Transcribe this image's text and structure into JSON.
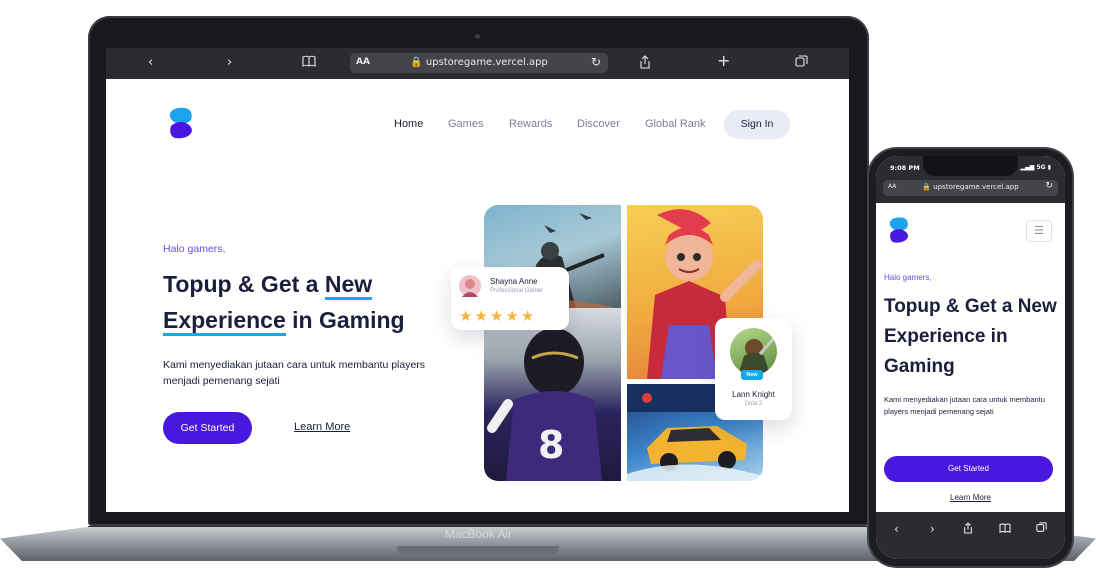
{
  "laptop": {
    "label": "MacBook Air",
    "toolbar": {
      "back_icon": "chevron-left-icon",
      "forward_icon": "chevron-right-icon",
      "reader_icon": "book-icon",
      "text_size": "AA",
      "url": "upstoregame.vercel.app",
      "share_icon": "share-icon",
      "new_tab_icon": "plus-icon",
      "tabs_icon": "tabs-icon"
    }
  },
  "site": {
    "nav": [
      {
        "label": "Home",
        "active": true
      },
      {
        "label": "Games"
      },
      {
        "label": "Rewards"
      },
      {
        "label": "Discover"
      },
      {
        "label": "Global Rank"
      }
    ],
    "signin_label": "Sign In",
    "hero": {
      "greeting": "Halo gamers,",
      "title_part1": "Topup & Get a ",
      "title_highlight1": "New",
      "title_highlight2": "Experience",
      "title_part2": " in Gaming",
      "description": "Kami menyediakan jutaan cara untuk membantu players menjadi pemenang sejati",
      "cta_label": "Get Started",
      "secondary_label": "Learn More"
    },
    "review_card": {
      "name": "Shayna Anne",
      "role": "Professional Gamer",
      "rating": 5
    },
    "player_card": {
      "badge": "New",
      "name": "Lann Knight",
      "game": "Dota 2"
    },
    "colors": {
      "primary": "#4a17de",
      "accent": "#1ca4ee",
      "text": "#1b1f3b",
      "greeting": "#6f4bf2",
      "star": "#f3b73e"
    }
  },
  "phone": {
    "time": "9:08 PM",
    "signal": "5G",
    "text_size": "AA",
    "url": "upstoregame.vercel.app",
    "menu_icon": "hamburger-icon",
    "greeting": "Halo gamers,",
    "title": "Topup & Get a New Experience in Gaming",
    "description": "Kami menyediakan jutaan cara untuk membantu players menjadi pemenang sejati",
    "cta_label": "Get Started",
    "secondary_label": "Learn More"
  }
}
